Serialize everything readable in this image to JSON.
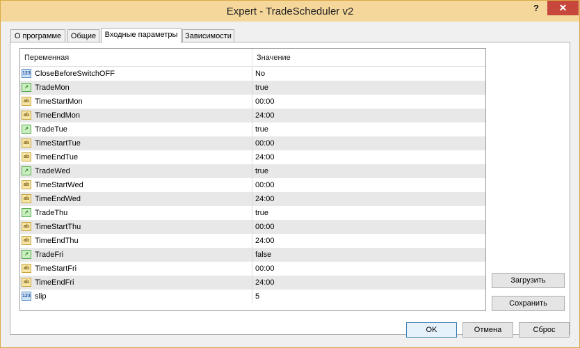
{
  "window": {
    "title": "Expert - TradeScheduler v2",
    "help_label": "?",
    "close_label": "✕"
  },
  "tabs": [
    "О программе",
    "Общие",
    "Входные параметры",
    "Зависимости"
  ],
  "grid": {
    "headers": {
      "variable": "Переменная",
      "value": "Значение"
    },
    "rows": [
      {
        "type": "int",
        "icon": "123",
        "name": "CloseBeforeSwitchOFF",
        "value": "No"
      },
      {
        "type": "bool",
        "icon": "↗",
        "name": "TradeMon",
        "value": "true"
      },
      {
        "type": "str",
        "icon": "ab",
        "name": "TimeStartMon",
        "value": "00:00"
      },
      {
        "type": "str",
        "icon": "ab",
        "name": "TimeEndMon",
        "value": "24:00"
      },
      {
        "type": "bool",
        "icon": "↗",
        "name": "TradeTue",
        "value": "true"
      },
      {
        "type": "str",
        "icon": "ab",
        "name": "TimeStartTue",
        "value": "00:00"
      },
      {
        "type": "str",
        "icon": "ab",
        "name": "TimeEndTue",
        "value": "24:00"
      },
      {
        "type": "bool",
        "icon": "↗",
        "name": "TradeWed",
        "value": "true"
      },
      {
        "type": "str",
        "icon": "ab",
        "name": "TimeStartWed",
        "value": "00:00"
      },
      {
        "type": "str",
        "icon": "ab",
        "name": "TimeEndWed",
        "value": "24:00"
      },
      {
        "type": "bool",
        "icon": "↗",
        "name": "TradeThu",
        "value": "true"
      },
      {
        "type": "str",
        "icon": "ab",
        "name": "TimeStartThu",
        "value": "00:00"
      },
      {
        "type": "str",
        "icon": "ab",
        "name": "TimeEndThu",
        "value": "24:00"
      },
      {
        "type": "bool",
        "icon": "↗",
        "name": "TradeFri",
        "value": "false"
      },
      {
        "type": "str",
        "icon": "ab",
        "name": "TimeStartFri",
        "value": "00:00"
      },
      {
        "type": "str",
        "icon": "ab",
        "name": "TimeEndFri",
        "value": "24:00"
      },
      {
        "type": "int",
        "icon": "123",
        "name": "slip",
        "value": "5"
      }
    ]
  },
  "side_buttons": {
    "load": "Загрузить",
    "save": "Сохранить"
  },
  "footer_buttons": {
    "ok": "OK",
    "cancel": "Отмена",
    "reset": "Сброс"
  },
  "icons": {
    "int": "int-param-icon",
    "bool": "bool-param-icon",
    "str": "string-param-icon"
  },
  "colors": {
    "titlebar": "#f5d79b",
    "close": "#c7473c",
    "row_alt": "#e8e8e8"
  }
}
